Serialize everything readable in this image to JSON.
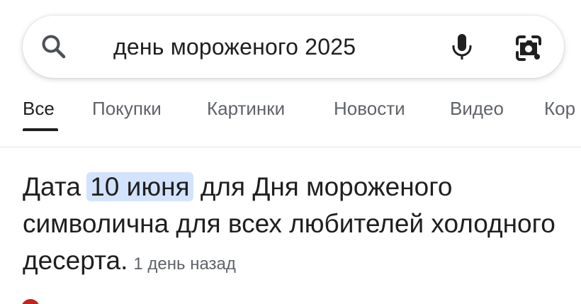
{
  "search": {
    "query": "день мороженого 2025"
  },
  "tabs": [
    {
      "label": "Все",
      "active": true
    },
    {
      "label": "Покупки",
      "active": false
    },
    {
      "label": "Картинки",
      "active": false
    },
    {
      "label": "Новости",
      "active": false
    },
    {
      "label": "Видео",
      "active": false
    },
    {
      "label": "Кор",
      "active": false
    }
  ],
  "result": {
    "text_before": "Дата ",
    "highlight": "10 июня",
    "text_after": " для Дня мороженого символична для всех любителей холодного десерта.",
    "time": "1 день назад"
  },
  "colors": {
    "highlight_bg": "#d3e3fd",
    "secondary_text": "#5f6368",
    "source_icon": "#c5221f"
  },
  "icons": {
    "search": "search-icon",
    "mic": "mic-icon",
    "lens": "lens-icon"
  }
}
